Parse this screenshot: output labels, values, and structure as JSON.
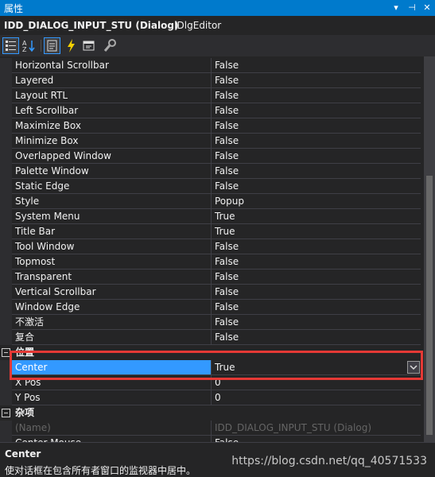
{
  "window": {
    "title": "属性"
  },
  "object": {
    "name": "IDD_DIALOG_INPUT_STU (Dialog)",
    "type": "IDlgEditor"
  },
  "toolbar": {
    "buttons": [
      "categorized-icon",
      "alphabetical-icon",
      "properties-icon",
      "events-icon",
      "messages-icon",
      "property-pages-icon"
    ]
  },
  "properties": [
    {
      "name": "Horizontal Scrollbar",
      "value": "False"
    },
    {
      "name": "Layered",
      "value": "False"
    },
    {
      "name": "Layout RTL",
      "value": "False"
    },
    {
      "name": "Left Scrollbar",
      "value": "False"
    },
    {
      "name": "Maximize Box",
      "value": "False"
    },
    {
      "name": "Minimize Box",
      "value": "False"
    },
    {
      "name": "Overlapped Window",
      "value": "False"
    },
    {
      "name": "Palette Window",
      "value": "False"
    },
    {
      "name": "Static Edge",
      "value": "False"
    },
    {
      "name": "Style",
      "value": "Popup"
    },
    {
      "name": "System Menu",
      "value": "True"
    },
    {
      "name": "Title Bar",
      "value": "True"
    },
    {
      "name": "Tool Window",
      "value": "False"
    },
    {
      "name": "Topmost",
      "value": "False"
    },
    {
      "name": "Transparent",
      "value": "False"
    },
    {
      "name": "Vertical Scrollbar",
      "value": "False"
    },
    {
      "name": "Window Edge",
      "value": "False"
    },
    {
      "name": "不激活",
      "value": "False"
    },
    {
      "name": "复合",
      "value": "False"
    }
  ],
  "categories": {
    "position": {
      "label": "位置"
    },
    "misc": {
      "label": "杂项"
    }
  },
  "position_props": [
    {
      "name": "Center",
      "value": "True"
    },
    {
      "name": "X Pos",
      "value": "0"
    },
    {
      "name": "Y Pos",
      "value": "0"
    }
  ],
  "misc_props": [
    {
      "name": "(Name)",
      "value": "IDD_DIALOG_INPUT_STU (Dialog)"
    },
    {
      "name": "Center Mouse",
      "value": "False"
    }
  ],
  "description": {
    "title": "Center",
    "text": "使对话框在包含所有者窗口的监视器中居中。"
  },
  "watermark": "https://blog.csdn.net/qq_40571533",
  "colors": {
    "accent": "#007acc",
    "selection": "#3399ff",
    "highlight_box": "#e53935",
    "background": "#252526"
  }
}
